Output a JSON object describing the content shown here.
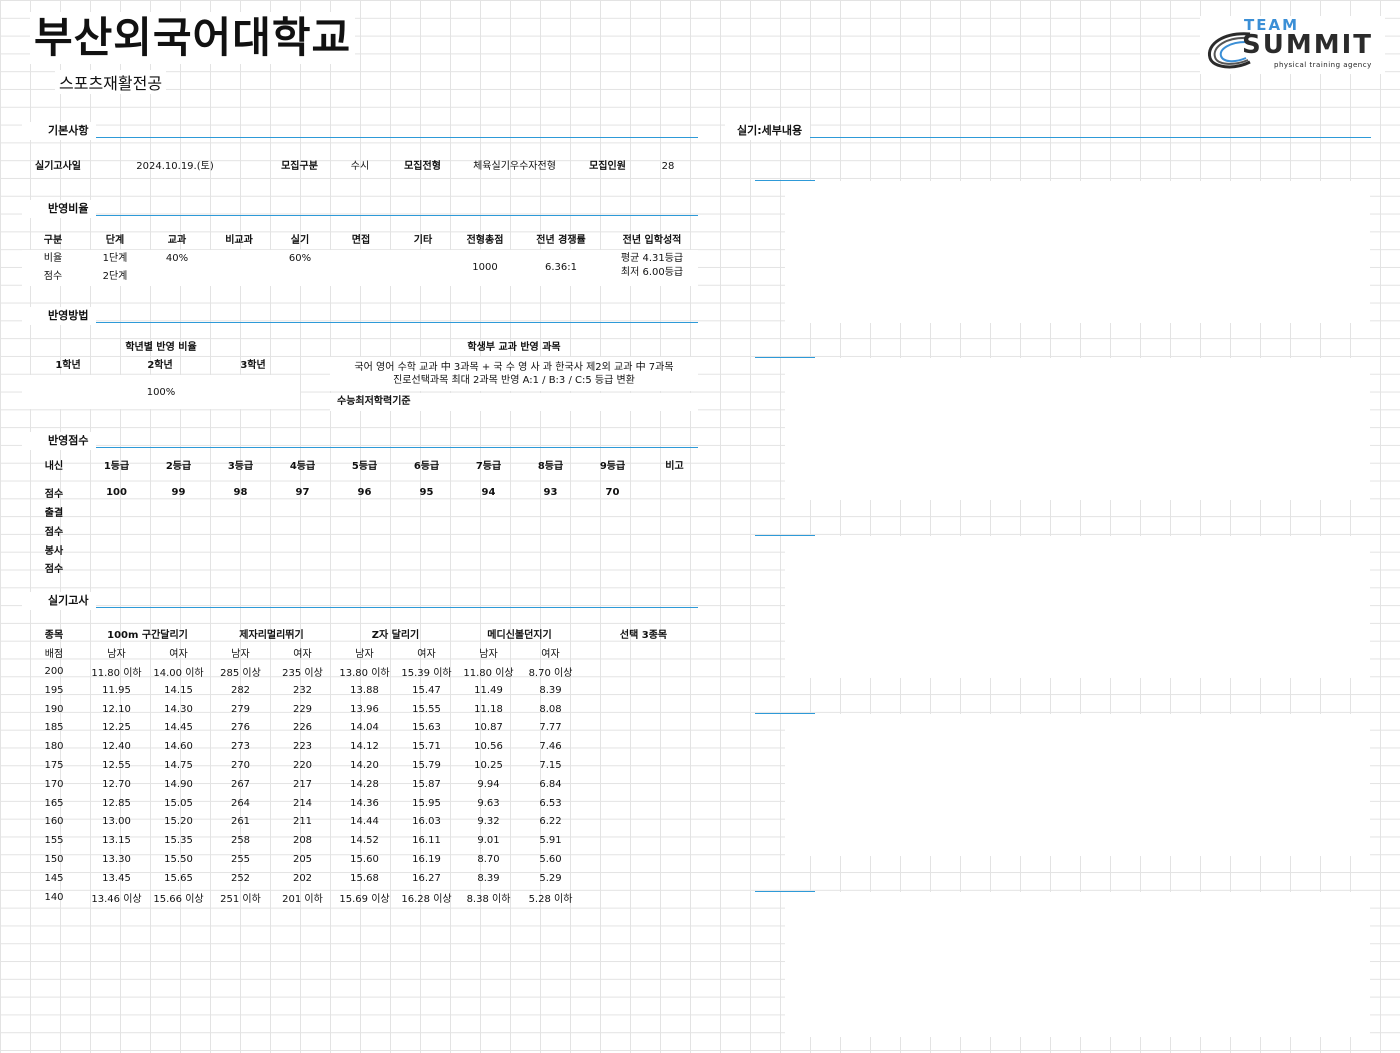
{
  "header": {
    "title": "부산외국어대학교",
    "subtitle": "스포츠재활전공",
    "logo": {
      "team": "TEAM",
      "summit": "SUMMIT",
      "tagline": "physical training agency"
    }
  },
  "sections": {
    "basic": "기본사항",
    "ratio": "반영비율",
    "method": "반영방법",
    "score": "반영점수",
    "practical": "실기고사",
    "detail": "실기:세부내용"
  },
  "basic": {
    "exam_date_label": "실기고사일",
    "exam_date": "2024.10.19.(토)",
    "type_label": "모집구분",
    "type": "수시",
    "track_label": "모집전형",
    "track": "체육실기우수자전형",
    "quota_label": "모집인원",
    "quota": "28"
  },
  "ratio": {
    "headers": [
      "구분",
      "단계",
      "교과",
      "비교과",
      "실기",
      "면접",
      "기타",
      "전형총점",
      "전년 경쟁률",
      "전년 입학성적"
    ],
    "row1": {
      "label": "비율",
      "stage": "1단계",
      "subject": "40%",
      "practical": "60%"
    },
    "row2": {
      "label": "점수",
      "stage": "2단계"
    },
    "total": "1000",
    "competition": "6.36:1",
    "prev_grade1": "평균 4.31등급",
    "prev_grade2": "최저 6.00등급"
  },
  "method": {
    "grade_ratio_title": "학년별 반영 비율",
    "grades": [
      "1학년",
      "2학년",
      "3학년"
    ],
    "grade_ratio": "100%",
    "subjects_title": "학생부 교과 반영 과목",
    "subjects_line1": "국어 영어 수학 교과 中 3과목 + 국 수 영 사 과 한국사 제2외 교과 中 7과목",
    "subjects_line2": "진로선택과목 최대 2과목 반영 A:1 / B:3 / C:5 등급 변환",
    "csat_label": "수능최저학력기준"
  },
  "score": {
    "headers": [
      "내신",
      "1등급",
      "2등급",
      "3등급",
      "4등급",
      "5등급",
      "6등급",
      "7등급",
      "8등급",
      "9등급",
      "비고"
    ],
    "row_label": "점수",
    "values": [
      "100",
      "99",
      "98",
      "97",
      "96",
      "95",
      "94",
      "93",
      "70"
    ],
    "extra_rows": [
      "출결",
      "점수",
      "봉사",
      "점수"
    ]
  },
  "practical": {
    "headers": [
      "종목",
      "100m 구간달리기",
      "제자리멀리뛰기",
      "Z자 달리기",
      "메디신볼던지기",
      "선택 3종목"
    ],
    "sub_label": "배점",
    "male": "남자",
    "female": "여자",
    "rows": [
      [
        "200",
        "11.80 이하",
        "14.00 이하",
        "285 이상",
        "235 이상",
        "13.80 이하",
        "15.39 이하",
        "11.80 이상",
        "8.70 이상"
      ],
      [
        "195",
        "11.95",
        "14.15",
        "282",
        "232",
        "13.88",
        "15.47",
        "11.49",
        "8.39"
      ],
      [
        "190",
        "12.10",
        "14.30",
        "279",
        "229",
        "13.96",
        "15.55",
        "11.18",
        "8.08"
      ],
      [
        "185",
        "12.25",
        "14.45",
        "276",
        "226",
        "14.04",
        "15.63",
        "10.87",
        "7.77"
      ],
      [
        "180",
        "12.40",
        "14.60",
        "273",
        "223",
        "14.12",
        "15.71",
        "10.56",
        "7.46"
      ],
      [
        "175",
        "12.55",
        "14.75",
        "270",
        "220",
        "14.20",
        "15.79",
        "10.25",
        "7.15"
      ],
      [
        "170",
        "12.70",
        "14.90",
        "267",
        "217",
        "14.28",
        "15.87",
        "9.94",
        "6.84"
      ],
      [
        "165",
        "12.85",
        "15.05",
        "264",
        "214",
        "14.36",
        "15.95",
        "9.63",
        "6.53"
      ],
      [
        "160",
        "13.00",
        "15.20",
        "261",
        "211",
        "14.44",
        "16.03",
        "9.32",
        "6.22"
      ],
      [
        "155",
        "13.15",
        "15.35",
        "258",
        "208",
        "14.52",
        "16.11",
        "9.01",
        "5.91"
      ],
      [
        "150",
        "13.30",
        "15.50",
        "255",
        "205",
        "15.60",
        "16.19",
        "8.70",
        "5.60"
      ],
      [
        "145",
        "13.45",
        "15.65",
        "252",
        "202",
        "15.68",
        "16.27",
        "8.39",
        "5.29"
      ],
      [
        "140",
        "13.46 이상",
        "15.66 이상",
        "251 이하",
        "201 이하",
        "15.69 이상",
        "16.28 이상",
        "8.38 이하",
        "5.28 이하"
      ]
    ]
  }
}
